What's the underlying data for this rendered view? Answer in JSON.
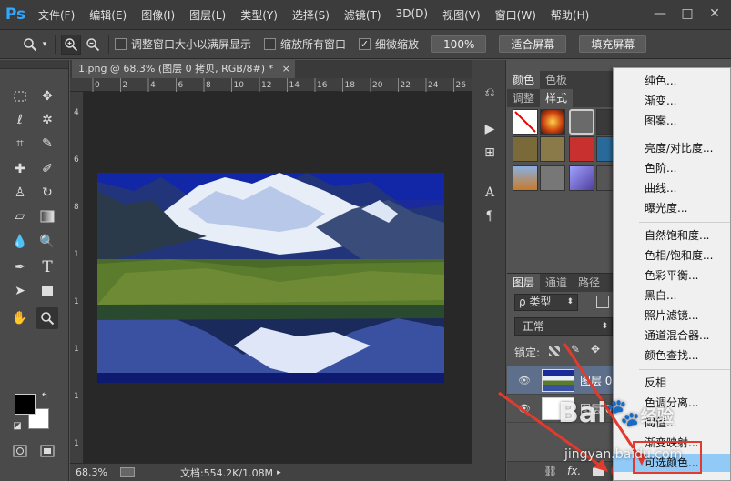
{
  "app": {
    "logo": "Ps"
  },
  "menubar": {
    "items": [
      "文件(F)",
      "编辑(E)",
      "图像(I)",
      "图层(L)",
      "类型(Y)",
      "选择(S)",
      "滤镜(T)",
      "3D(D)",
      "视图(V)",
      "窗口(W)",
      "帮助(H)"
    ],
    "window_controls": [
      "—",
      "□",
      "✕"
    ]
  },
  "optionsbar": {
    "checkbox1": {
      "label": "调整窗口大小以满屏显示",
      "checked": false
    },
    "checkbox2": {
      "label": "缩放所有窗口",
      "checked": false
    },
    "checkbox3": {
      "label": "细微缩放",
      "checked": true
    },
    "zoom_btn": "100%",
    "fit_btn": "适合屏幕",
    "fill_btn": "填充屏幕"
  },
  "document": {
    "tab_title": "1.png @ 68.3% (图层 0 拷贝, RGB/8#) *",
    "tab_close": "×",
    "ruler_top": [
      "0",
      "2",
      "4",
      "6",
      "8",
      "10",
      "12",
      "14",
      "16",
      "18",
      "20",
      "22",
      "24",
      "26"
    ],
    "ruler_left": [
      "4",
      "6",
      "8",
      "1",
      "1",
      "1",
      "1",
      "1"
    ],
    "status_zoom": "68.3%",
    "status_doc": "文档:554.2K/1.08M"
  },
  "panels": {
    "top_tabs_row1": [
      "颜色",
      "色板"
    ],
    "top_tabs_row2": [
      "调整",
      "样式"
    ],
    "layer_tabs": [
      "图层",
      "通道",
      "路径"
    ],
    "filter_label": "ρ 类型",
    "blend_mode": "正常",
    "lock_label": "锁定:",
    "layers": [
      {
        "name": "图层 0",
        "visible": true
      },
      {
        "name": "图层 0",
        "visible": true
      }
    ],
    "footer_icons": [
      "link-icon",
      "fx-icon",
      "mask-icon"
    ],
    "footer_fx": "fx."
  },
  "dropdown": {
    "groups": [
      [
        "纯色...",
        "渐变...",
        "图案..."
      ],
      [
        "亮度/对比度...",
        "色阶...",
        "曲线...",
        "曝光度..."
      ],
      [
        "自然饱和度...",
        "色相/饱和度...",
        "色彩平衡...",
        "黑白...",
        "照片滤镜...",
        "通道混合器...",
        "颜色查找..."
      ],
      [
        "反相",
        "色调分离...",
        "阈值...",
        "渐变映射...",
        "可选颜色..."
      ]
    ],
    "highlighted": "可选颜色..."
  },
  "watermark": {
    "brand": "Bai",
    "brand_suffix": "经验",
    "url": "jingyan.baidu.com"
  },
  "colors": {
    "accent": "#31a8ff",
    "highlight": "#91c9f7",
    "annotation": "#e23b2e"
  }
}
